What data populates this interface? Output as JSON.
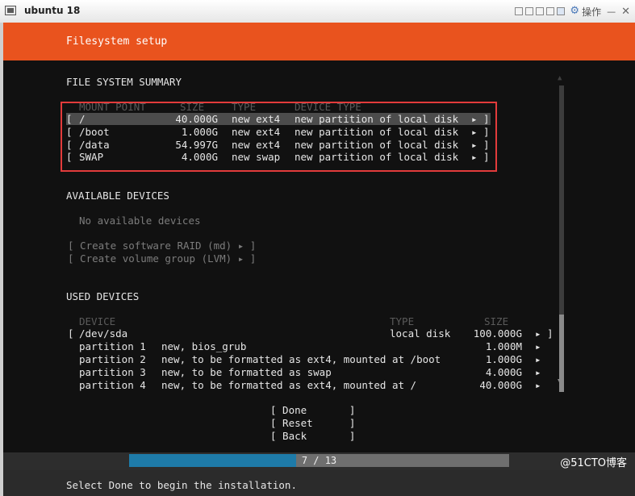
{
  "window": {
    "title": "ubuntu 18",
    "ops_label": "操作",
    "min_label": "—",
    "close_label": "✕"
  },
  "installer": {
    "header_title": "Filesystem setup",
    "fs_summary": {
      "heading": "FILE SYSTEM SUMMARY",
      "columns": {
        "mount": "MOUNT POINT",
        "size": "SIZE",
        "type": "TYPE",
        "device_type": "DEVICE TYPE"
      },
      "rows": [
        {
          "open": "[ ",
          "mount": "/",
          "size": "40.000G",
          "type": "new ext4",
          "device_type": "new partition of local disk",
          "close": "▸ ]"
        },
        {
          "open": "[ ",
          "mount": "/boot",
          "size": "1.000G",
          "type": "new ext4",
          "device_type": "new partition of local disk",
          "close": "▸ ]"
        },
        {
          "open": "[ ",
          "mount": "/data",
          "size": "54.997G",
          "type": "new ext4",
          "device_type": "new partition of local disk",
          "close": "▸ ]"
        },
        {
          "open": "[ ",
          "mount": "SWAP",
          "size": "4.000G",
          "type": "new swap",
          "device_type": "new partition of local disk",
          "close": "▸ ]"
        }
      ]
    },
    "available": {
      "heading": "AVAILABLE DEVICES",
      "empty_text": "No available devices",
      "create_raid": "[ Create software RAID (md) ▸ ]",
      "create_lvm": "[ Create volume group (LVM) ▸ ]"
    },
    "used": {
      "heading": "USED DEVICES",
      "columns": {
        "device": "DEVICE",
        "type": "TYPE",
        "size": "SIZE"
      },
      "disk": {
        "open": "[ ",
        "name": "/dev/sda",
        "type": "local disk",
        "size": "100.000G",
        "close": "▸ ]"
      },
      "partitions": [
        {
          "name": "partition 1",
          "desc": "new, bios_grub",
          "size": "1.000M",
          "arrow": "▸"
        },
        {
          "name": "partition 2",
          "desc": "new, to be formatted as ext4, mounted at /boot",
          "size": "1.000G",
          "arrow": "▸"
        },
        {
          "name": "partition 3",
          "desc": "new, to be formatted as swap",
          "size": "4.000G",
          "arrow": "▸"
        },
        {
          "name": "partition 4",
          "desc": "new, to be formatted as ext4, mounted at /",
          "size": "40.000G",
          "arrow": "▸"
        }
      ]
    },
    "scroll": {
      "up": "▲",
      "down": "▼"
    },
    "buttons": {
      "done": "[ Done       ]",
      "reset": "[ Reset      ]",
      "back": "[ Back       ]"
    },
    "progress": {
      "text": "7 / 13",
      "current": 7,
      "total": 13,
      "fraction": 0.44
    },
    "footer_text": "Select Done to begin the installation."
  },
  "watermark": "@51CTO博客"
}
